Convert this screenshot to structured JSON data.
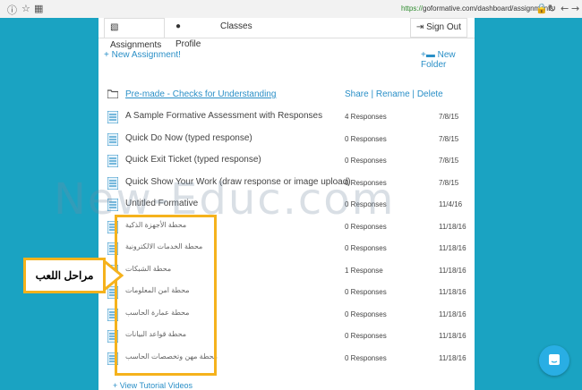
{
  "browser": {
    "url_scheme": "https://",
    "url_rest": "goformative.com/dashboard/assignments"
  },
  "tabs": [
    {
      "label": "Assignments"
    },
    {
      "label": "Profile"
    },
    {
      "label": "Classes"
    }
  ],
  "sign_out": "Sign Out",
  "new_assignment": "New Assignment!",
  "new_folder": "New Folder",
  "folder": {
    "name": "Pre-made - Checks for Understanding",
    "share": "Share",
    "rename": "Rename",
    "delete": "Delete"
  },
  "rows": [
    {
      "title": "A Sample Formative Assessment with Responses",
      "responses": "4 Responses",
      "date": "7/8/15"
    },
    {
      "title": "Quick Do Now (typed response)",
      "responses": "0 Responses",
      "date": "7/8/15"
    },
    {
      "title": "Quick Exit Ticket (typed response)",
      "responses": "0 Responses",
      "date": "7/8/15"
    },
    {
      "title": "Quick Show Your Work (draw response or image upload)",
      "responses": "0 Responses",
      "date": "7/8/15"
    },
    {
      "title": "Untitled Formative",
      "responses": "0 Responses",
      "date": "11/4/16"
    },
    {
      "title": "محطة الأجهزة الذكية",
      "responses": "0 Responses",
      "date": "11/18/16"
    },
    {
      "title": "محطة الخدمات الالكترونية",
      "responses": "0 Responses",
      "date": "11/18/16"
    },
    {
      "title": "محطة الشبكات",
      "responses": "1 Response",
      "date": "11/18/16"
    },
    {
      "title": "محطة امن المعلومات",
      "responses": "0 Responses",
      "date": "11/18/16"
    },
    {
      "title": "محطة عمارة الحاسب",
      "responses": "0 Responses",
      "date": "11/18/16"
    },
    {
      "title": "محطة قواعد البيانات",
      "responses": "0 Responses",
      "date": "11/18/16"
    },
    {
      "title": "محطة مهن وتخصصات الحاسب",
      "responses": "0 Responses",
      "date": "11/18/16"
    }
  ],
  "footer_link": "View Tutorial Videos",
  "watermark": "New-Educ.com",
  "callout": "مراحل اللعب",
  "colors": {
    "accent": "#2a8fc7",
    "highlight": "#f5b21c",
    "background": "#1aa3c2"
  }
}
